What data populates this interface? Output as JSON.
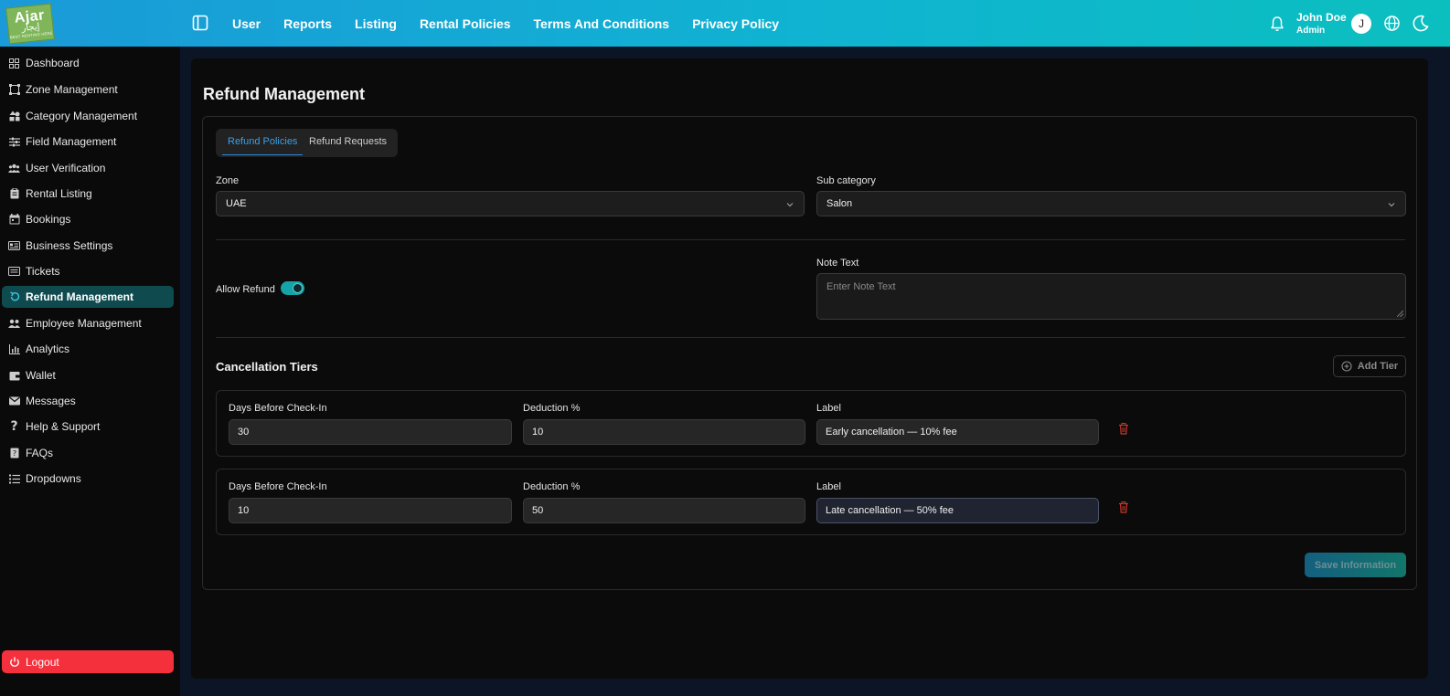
{
  "logo": {
    "line1": "Ajar",
    "line2": "إيجار",
    "line3": "BEST RENTING HERE"
  },
  "nav": {
    "items": [
      "User",
      "Reports",
      "Listing",
      "Rental Policies",
      "Terms And Conditions",
      "Privacy Policy"
    ]
  },
  "user": {
    "name": "John Doe",
    "role": "Admin",
    "initial": "J"
  },
  "sidebar": {
    "items": [
      {
        "label": "Dashboard",
        "icon": "dashboard-icon"
      },
      {
        "label": "Zone Management",
        "icon": "zone-icon"
      },
      {
        "label": "Category Management",
        "icon": "category-icon"
      },
      {
        "label": "Field Management",
        "icon": "sliders-icon"
      },
      {
        "label": "User Verification",
        "icon": "users-icon"
      },
      {
        "label": "Rental Listing",
        "icon": "clipboard-icon"
      },
      {
        "label": "Bookings",
        "icon": "calendar-icon"
      },
      {
        "label": "Business Settings",
        "icon": "id-card-icon"
      },
      {
        "label": "Tickets",
        "icon": "ticket-icon"
      },
      {
        "label": "Refund Management",
        "icon": "refund-icon"
      },
      {
        "label": "Employee Management",
        "icon": "people-icon"
      },
      {
        "label": "Analytics",
        "icon": "analytics-icon"
      },
      {
        "label": "Wallet",
        "icon": "wallet-icon"
      },
      {
        "label": "Messages",
        "icon": "mail-icon"
      },
      {
        "label": "Help & Support",
        "icon": "question-icon"
      },
      {
        "label": "FAQs",
        "icon": "faq-icon"
      },
      {
        "label": "Dropdowns",
        "icon": "list-icon"
      }
    ],
    "active": "Refund Management",
    "logout_label": "Logout"
  },
  "page": {
    "title": "Refund Management",
    "tabs": [
      {
        "label": "Refund Policies",
        "active": true
      },
      {
        "label": "Refund Requests",
        "active": false
      }
    ],
    "zone": {
      "label": "Zone",
      "value": "UAE"
    },
    "sub_category": {
      "label": "Sub category",
      "value": "Salon"
    },
    "allow_refund": {
      "label": "Allow Refund",
      "enabled": true
    },
    "note_text": {
      "label": "Note Text",
      "placeholder": "Enter Note Text",
      "value": ""
    },
    "cancellation": {
      "title": "Cancellation Tiers",
      "add_label": "Add Tier",
      "tiers": [
        {
          "days_label": "Days Before Check-In",
          "days": "30",
          "deduction_label": "Deduction %",
          "deduction": "10",
          "label_label": "Label",
          "label": "Early cancellation — 10% fee"
        },
        {
          "days_label": "Days Before Check-In",
          "days": "10",
          "deduction_label": "Deduction %",
          "deduction": "50",
          "label_label": "Label",
          "label": "Late cancellation — 50% fee"
        }
      ]
    },
    "save_label": "Save Information"
  },
  "colors": {
    "accent": "#16a3a8",
    "danger": "#f5303d",
    "tab_active": "#3aa0e8",
    "trash": "#c0392b"
  }
}
